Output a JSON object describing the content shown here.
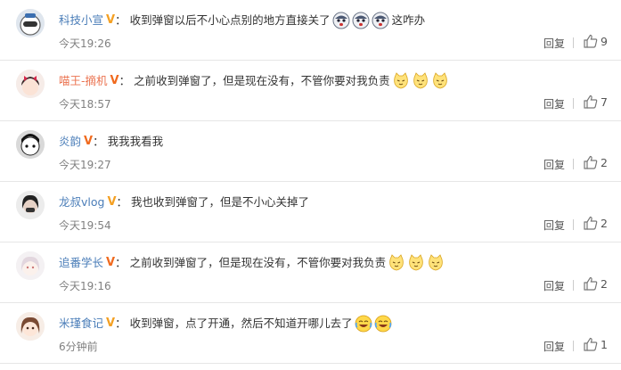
{
  "comments": [
    {
      "user": "科技小宣",
      "name_color": "#4a7db8",
      "vip": "gold",
      "text": "收到弹窗以后不小心点别的地方直接关了",
      "emojis": [
        "shocked-face-emoji",
        "shocked-face-emoji",
        "shocked-face-emoji"
      ],
      "trailing": "这咋办",
      "time": "今天19:26",
      "reply": "回复",
      "likes": "9"
    },
    {
      "user": "喵王-摘机",
      "name_color": "#eb7350",
      "vip": "orange",
      "text": "之前收到弹窗了，但是现在没有，不管你要对我负责",
      "emojis": [
        "cat-face-emoji",
        "cat-face-emoji",
        "cat-face-emoji"
      ],
      "trailing": "",
      "time": "今天18:57",
      "reply": "回复",
      "likes": "7"
    },
    {
      "user": "炎韵",
      "name_color": "#4a7db8",
      "vip": "orange",
      "text": "我我我看我",
      "emojis": [],
      "trailing": "",
      "time": "今天19:27",
      "reply": "回复",
      "likes": "2"
    },
    {
      "user": "龙叔vlog",
      "name_color": "#4a7db8",
      "vip": "gold",
      "text": "我也收到弹窗了，但是不小心关掉了",
      "emojis": [],
      "trailing": "",
      "time": "今天19:54",
      "reply": "回复",
      "likes": "2"
    },
    {
      "user": "追番学长",
      "name_color": "#4a7db8",
      "vip": "orange",
      "text": "之前收到弹窗了，但是现在没有，不管你要对我负责",
      "emojis": [
        "cat-face-emoji",
        "cat-face-emoji",
        "cat-face-emoji"
      ],
      "trailing": "",
      "time": "今天19:16",
      "reply": "回复",
      "likes": "2"
    },
    {
      "user": "米瑾食记",
      "name_color": "#4a7db8",
      "vip": "gold",
      "text": "收到弹窗，点了开通，然后不知道开哪儿去了",
      "emojis": [
        "laughing-crying-emoji",
        "laughing-crying-emoji"
      ],
      "trailing": "",
      "time": "6分钟前",
      "reply": "回复",
      "likes": "1"
    }
  ]
}
